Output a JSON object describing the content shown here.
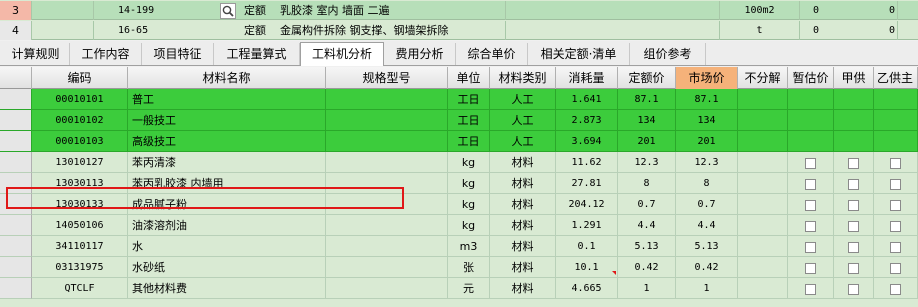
{
  "top_rows": [
    {
      "num": "3",
      "code": "14-199",
      "type": "定额",
      "name": "乳胶漆 室内 墙面 二遍",
      "unit": "100m2",
      "v1": "0",
      "v2": "0"
    },
    {
      "num": "4",
      "code": "16-65",
      "type": "定额",
      "name": "金属构件拆除 钢支撑、钢墙架拆除",
      "unit": "t",
      "v1": "0",
      "v2": "0"
    }
  ],
  "tabs": [
    "计算规则",
    "工作内容",
    "项目特征",
    "工程量算式",
    "工料机分析",
    "费用分析",
    "综合单价",
    "相关定额·清单",
    "组价参考"
  ],
  "active_tab": "工料机分析",
  "headers": [
    "编码",
    "材料名称",
    "规格型号",
    "单位",
    "材料类别",
    "消耗量",
    "定额价",
    "市场价",
    "不分解",
    "暂估价",
    "甲供",
    "乙供主"
  ],
  "rows": [
    {
      "code": "00010101",
      "name": "普工",
      "unit": "工日",
      "cat": "人工",
      "qty": "1.641",
      "price": "87.1",
      "market": "87.1",
      "green": true
    },
    {
      "code": "00010102",
      "name": "一般技工",
      "unit": "工日",
      "cat": "人工",
      "qty": "2.873",
      "price": "134",
      "market": "134",
      "green": true
    },
    {
      "code": "00010103",
      "name": "高级技工",
      "unit": "工日",
      "cat": "人工",
      "qty": "3.694",
      "price": "201",
      "market": "201",
      "green": true
    },
    {
      "code": "13010127",
      "name": "苯丙清漆",
      "unit": "kg",
      "cat": "材料",
      "qty": "11.62",
      "price": "12.3",
      "market": "12.3",
      "green": false
    },
    {
      "code": "13030113",
      "name": "苯丙乳胶漆 内墙用",
      "unit": "kg",
      "cat": "材料",
      "qty": "27.81",
      "price": "8",
      "market": "8",
      "green": false
    },
    {
      "code": "13030133",
      "name": "成品腻子粉",
      "unit": "kg",
      "cat": "材料",
      "qty": "204.12",
      "price": "0.7",
      "market": "0.7",
      "green": false
    },
    {
      "code": "14050106",
      "name": "油漆溶剂油",
      "unit": "kg",
      "cat": "材料",
      "qty": "1.291",
      "price": "4.4",
      "market": "4.4",
      "green": false
    },
    {
      "code": "34110117",
      "name": "水",
      "unit": "m3",
      "cat": "材料",
      "qty": "0.1",
      "price": "5.13",
      "market": "5.13",
      "green": false
    },
    {
      "code": "03131975",
      "name": "水砂纸",
      "unit": "张",
      "cat": "材料",
      "qty": "10.1",
      "price": "0.42",
      "market": "0.42",
      "green": false
    },
    {
      "code": "QTCLF",
      "name": "其他材料费",
      "unit": "元",
      "cat": "材料",
      "qty": "4.665",
      "price": "1",
      "market": "1",
      "green": false
    }
  ]
}
